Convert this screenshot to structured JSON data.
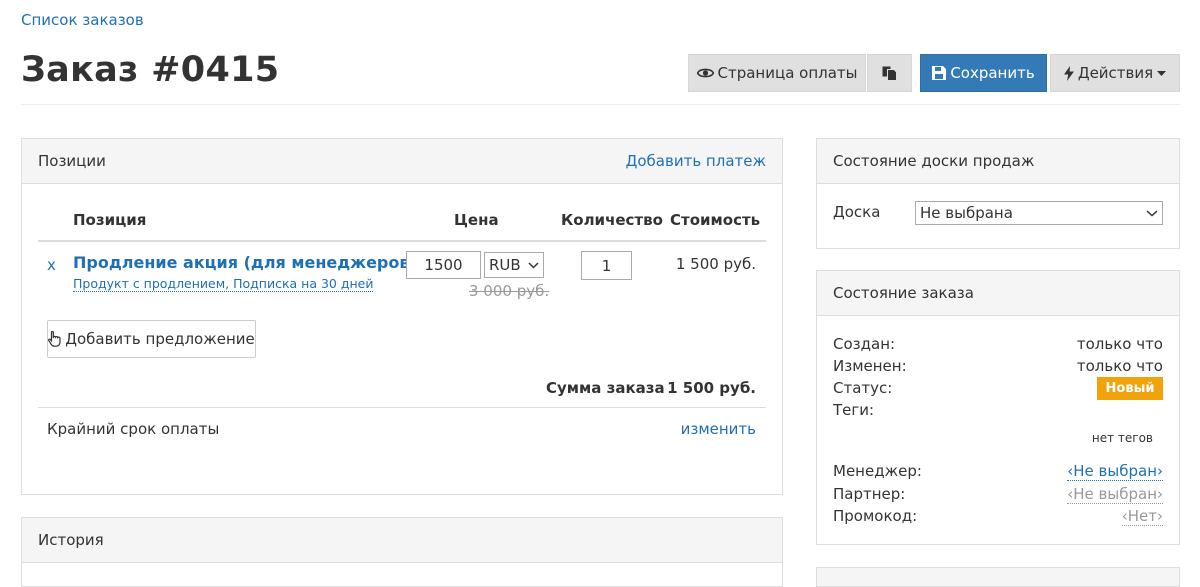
{
  "breadcrumb": "Список заказов",
  "page_title": "Заказ #0415",
  "toolbar": {
    "payment_page_label": "Страница оплаты",
    "save_label": "Сохранить",
    "actions_label": "Действия"
  },
  "positions_panel": {
    "title": "Позиции",
    "add_payment_link": "Добавить платеж",
    "columns": {
      "position": "Позиция",
      "price": "Цена",
      "quantity": "Количество",
      "cost": "Стоимость"
    },
    "items": [
      {
        "remove": "x",
        "name": "Продление акция (для менеджеров)",
        "subtitle": "Продукт с продлением, Подписка на 30 дней",
        "price_value": "1500",
        "currency": "RUB",
        "old_price": "3 000 руб.",
        "quantity": "1",
        "cost": "1 500 руб."
      }
    ],
    "add_offer_label": "Добавить предложение",
    "total_label": "Сумма заказа",
    "total_value": "1 500 руб.",
    "deadline_label": "Крайний срок оплаты",
    "deadline_change": "изменить"
  },
  "history_panel": {
    "title": "История"
  },
  "sales_board_panel": {
    "title": "Состояние доски продаж",
    "board_label": "Доска",
    "board_value": "Не выбрана"
  },
  "order_state_panel": {
    "title": "Состояние заказа",
    "created_label": "Создан:",
    "created_value": "только что",
    "modified_label": "Изменен:",
    "modified_value": "только что",
    "status_label": "Статус:",
    "status_value": "Новый",
    "tags_label": "Теги:",
    "tags_value": "нет тегов",
    "manager_label": "Менеджер:",
    "manager_value": "‹Не выбран›",
    "partner_label": "Партнер:",
    "partner_value": "‹Не выбран›",
    "promo_label": "Промокод:",
    "promo_value": "‹Нет›"
  },
  "colors": {
    "link": "#1f6fb5",
    "primary": "#337ab7",
    "status_new": "#f0a30a"
  },
  "icons": [
    "eye-icon",
    "copy-icon",
    "floppy-disk-icon",
    "lightning-icon",
    "caret-down-icon",
    "hand-pointer-icon",
    "chevron-down-icon"
  ]
}
